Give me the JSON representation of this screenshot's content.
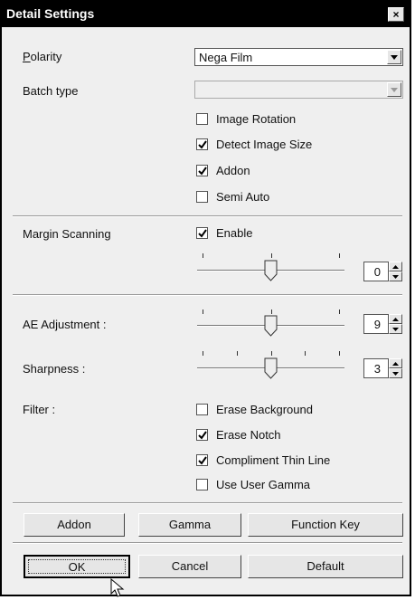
{
  "window": {
    "title": "Detail Settings",
    "close_glyph": "×"
  },
  "polarity": {
    "label": "Polarity",
    "value": "Nega Film"
  },
  "batch_type": {
    "label": "Batch type",
    "value": ""
  },
  "options": [
    {
      "label": "Image Rotation",
      "checked": false
    },
    {
      "label": "Detect Image Size",
      "checked": true
    },
    {
      "label": "Addon",
      "checked": true
    },
    {
      "label": "Semi Auto",
      "checked": false
    }
  ],
  "margin_scanning": {
    "label": "Margin Scanning",
    "enable_label": "Enable",
    "enabled": true,
    "value": "0"
  },
  "ae_adjustment": {
    "label": "AE Adjustment :",
    "value": "9"
  },
  "sharpness": {
    "label": "Sharpness :",
    "value": "3"
  },
  "filter": {
    "label": "Filter :",
    "items": [
      {
        "label": "Erase Background",
        "checked": false
      },
      {
        "label": "Erase Notch",
        "checked": true
      },
      {
        "label": "Compliment Thin Line",
        "checked": true
      },
      {
        "label": "Use User Gamma",
        "checked": false
      }
    ]
  },
  "buttons_row1": [
    "Addon",
    "Gamma",
    "Function Key"
  ],
  "buttons_row2": [
    "OK",
    "Cancel",
    "Default"
  ]
}
